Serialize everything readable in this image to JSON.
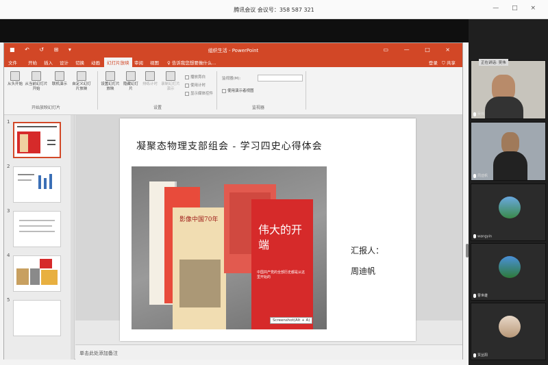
{
  "meeting": {
    "title": "腾讯会议 会议号：358 587 321",
    "window_controls": "— □ ×"
  },
  "powerpoint": {
    "quick_access": "■ ↶ ↺ ⊞ ▾",
    "title": "组织生活 - PowerPoint",
    "window_controls": "▭ — □ ×",
    "tabs": [
      "文件",
      "开始",
      "插入",
      "设计",
      "切换",
      "动画",
      "幻灯片放映",
      "审阅",
      "视图"
    ],
    "active_tab": "幻灯片放映",
    "tell_me": "♀ 告诉我您想要做什么...",
    "login": "登录",
    "share": "共享",
    "ribbon": {
      "buttons": [
        "从头开始",
        "从当前幻灯片开始",
        "联机演示",
        "自定义幻灯片放映",
        "设置幻灯片放映",
        "隐藏幻灯片",
        "排练计时",
        "录制幻灯片演示"
      ],
      "checkboxes": [
        "播放旁白",
        "使用计时",
        "显示媒体控件"
      ],
      "monitor_label": "监视器(M):",
      "presenter_view": "使用演示者视图",
      "groups": [
        "开始放映幻灯片",
        "设置",
        "监视器"
      ]
    },
    "slide_numbers": [
      "1",
      "2",
      "3",
      "4",
      "5"
    ],
    "notes_placeholder": "单击此处添加备注"
  },
  "slide": {
    "title": "凝聚态物理支部组会 - 学习四史心得体会",
    "reporter_label": "汇报人：",
    "reporter_name": "周迪帆",
    "book_texts": {
      "book2_title": "影像中国70年",
      "book3_title": "伟大的开端",
      "book3_sub": "中国共产党的全部历史都是从这里开始的",
      "screenshot_tip": "Screenshot(Alt + A)"
    }
  },
  "participants": {
    "speaking": "正在讲话: 吴伟",
    "names": [
      "吴伟",
      "周迪帆",
      "wangyin",
      "曹世雄",
      "贾丛阳"
    ]
  },
  "colors": {
    "powerpoint_accent": "#d24726",
    "book_red": "#d62a2a"
  }
}
